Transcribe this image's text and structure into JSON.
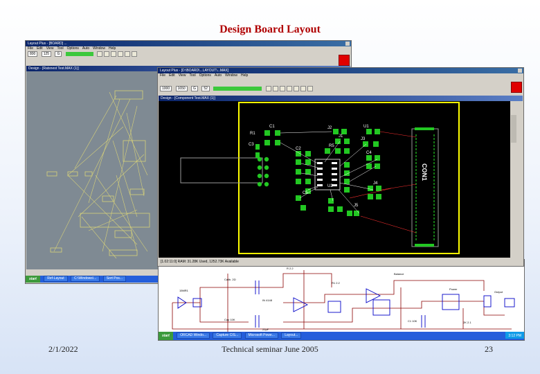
{
  "slide": {
    "title": "Design Board Layout",
    "footer_date": "2/1/2022",
    "footer_center": "Technical seminar June 2005",
    "page_number": "23"
  },
  "back_window": {
    "title": "Layout Plus - [BOARD] ...",
    "menu": [
      "File",
      "Edit",
      "View",
      "Tool",
      "Options",
      "Auto",
      "Window",
      "Help"
    ],
    "fields": [
      "800",
      "125",
      "G"
    ],
    "inner_title": "Design - [Ratsnest Test.MAX (1)]",
    "taskbar": {
      "start": "start",
      "items": [
        "Ref-Layout",
        "C:\\Windows\\...",
        "Sort Pos..."
      ]
    }
  },
  "front_window": {
    "title": "Layout Plus - [D:\\BOARD\\...LAYOUT\\...MAX]",
    "menu": [
      "File",
      "Edit",
      "View",
      "Tool",
      "Options",
      "Auto",
      "Window",
      "Help"
    ],
    "fields": [
      "1000",
      "1650",
      "G",
      "52"
    ],
    "inner_title": "Design - [Component Test.MAX (1)]",
    "status_bar": "[1.02:11:0] RAM: 31.28K Used, 1252.73K Available",
    "connector_label": "CON1",
    "component_labels": [
      "C1",
      "R1",
      "C3",
      "J2",
      "J1",
      "U1",
      "J3",
      "R5",
      "C4",
      "C2",
      "J4",
      "C5",
      "U2",
      "J5"
    ],
    "board_color": "#ffff00",
    "pad_color": "#22c822"
  },
  "schematic_window": {
    "labels": [
      "15MR1",
      "Calib. 2Ω",
      "R 2.2",
      "IN 4148",
      "Cap 10K",
      "R1 2.2",
      "22µF",
      "Balance",
      "Power",
      "Output",
      "C1 10K",
      "2K 2.1"
    ],
    "wire_color": "#8b0000",
    "component_color": "#0000c8",
    "taskbar": {
      "start": "start",
      "items": [
        "ORCAD Windo...",
        "Capture CIS...",
        "Microsoft Powe...",
        "Layout..."
      ],
      "clock": "3:12 PM"
    }
  }
}
